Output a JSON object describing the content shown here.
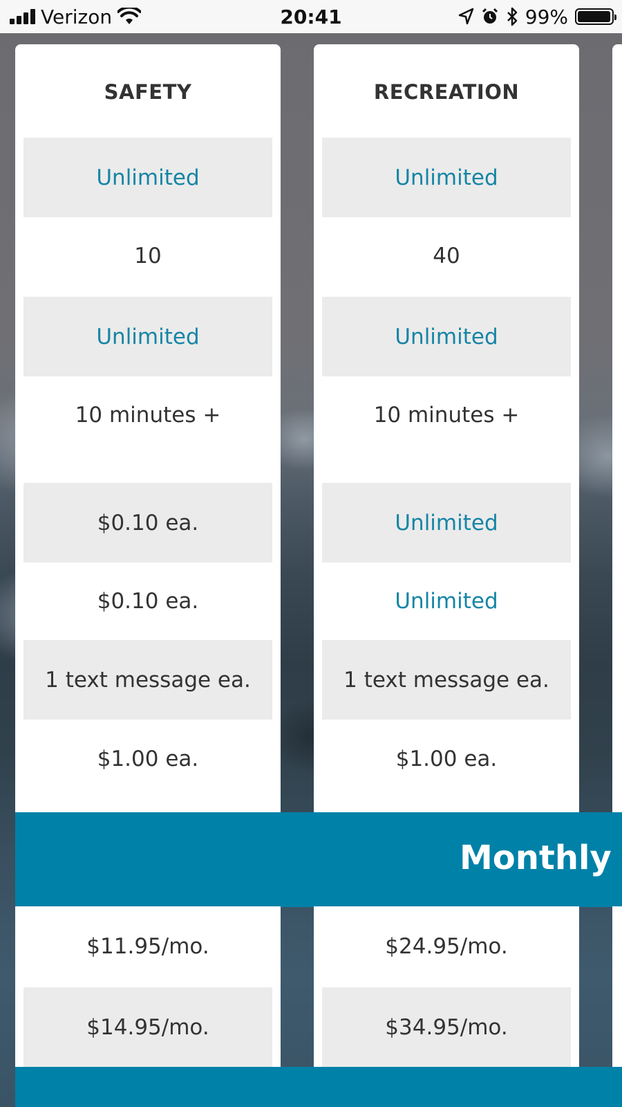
{
  "status_bar": {
    "carrier": "Verizon",
    "time": "20:41",
    "battery": "99%",
    "battery_level": 0.99
  },
  "plans": [
    {
      "name": "SAFETY",
      "features": [
        "Unlimited",
        "10",
        "Unlimited",
        "10 minutes +",
        "$0.10 ea.",
        "$0.10 ea.",
        "1 text message ea.",
        "$1.00 ea."
      ],
      "monthly": [
        "$11.95/mo.",
        "$14.95/mo."
      ]
    },
    {
      "name": "RECREATION",
      "features": [
        "Unlimited",
        "40",
        "Unlimited",
        "10 minutes +",
        "Unlimited",
        "Unlimited",
        "1 text message ea.",
        "$1.00 ea."
      ],
      "monthly": [
        "$24.95/mo.",
        "$34.95/mo."
      ]
    }
  ],
  "monthly_band": {
    "label": "Monthly C"
  },
  "colors": {
    "accent": "#1685a5",
    "band": "#0081a8",
    "cell_gray": "#ebebeb"
  },
  "icons": [
    "signal-icon",
    "wifi-icon",
    "location-arrow-icon",
    "alarm-icon",
    "bluetooth-icon",
    "battery-icon"
  ]
}
